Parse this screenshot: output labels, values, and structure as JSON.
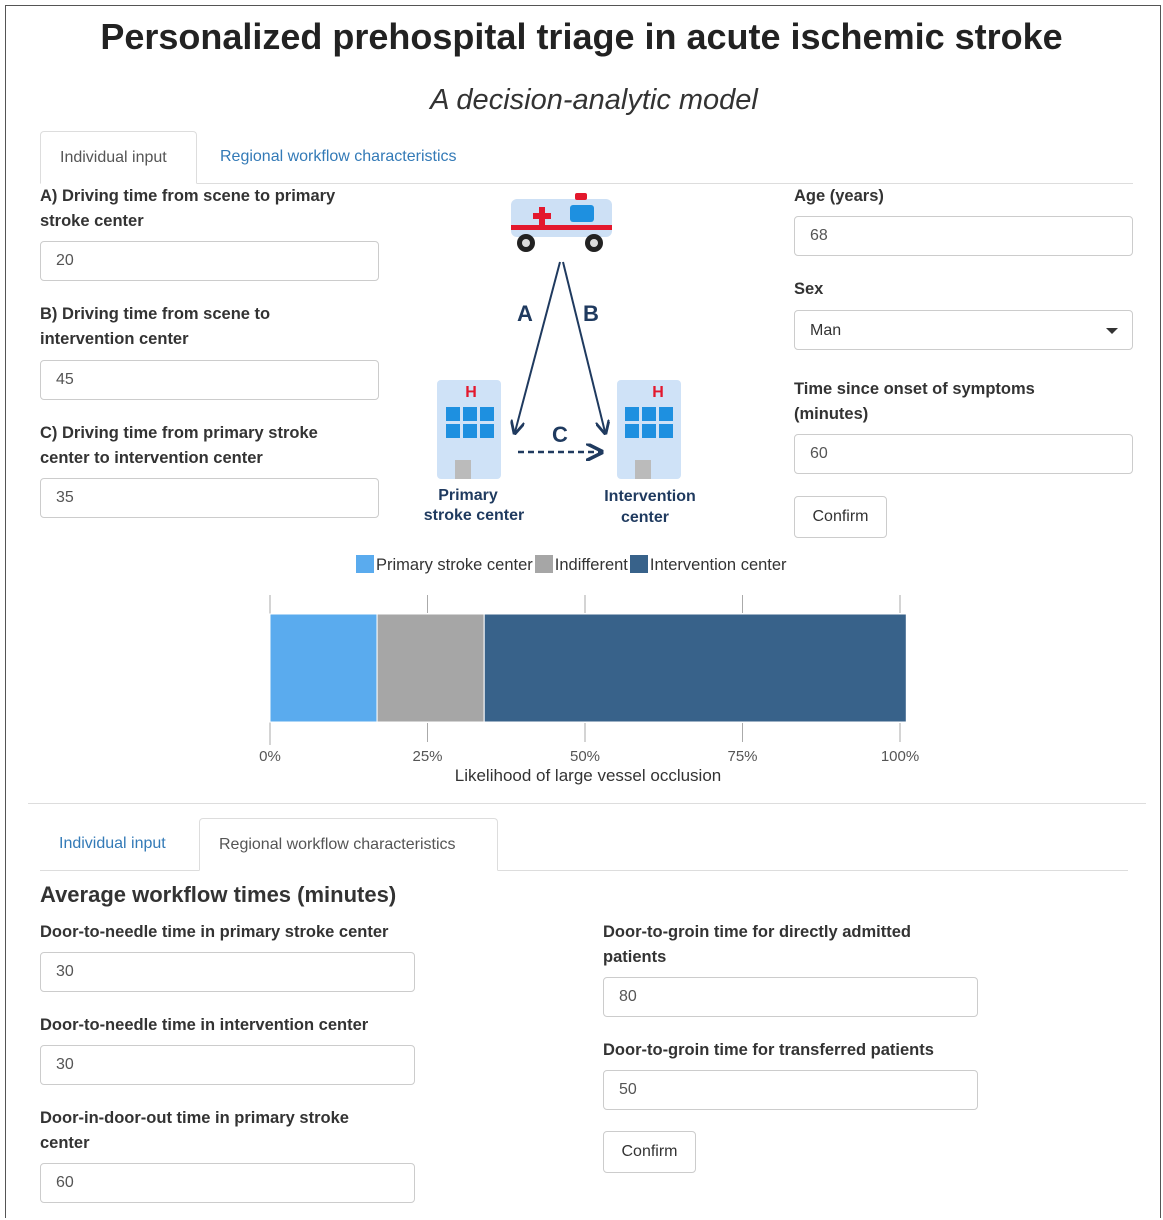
{
  "header": {
    "title": "Personalized prehospital triage in acute ischemic stroke",
    "subtitle": "A decision-analytic model"
  },
  "tabs_top": {
    "individual": "Individual input",
    "regional": "Regional workflow characteristics",
    "active": "individual"
  },
  "individual": {
    "a_label": "A) Driving time from scene to primary stroke center",
    "a_value": "20",
    "b_label": "B) Driving time from scene to intervention center",
    "b_value": "45",
    "c_label": "C) Driving time from primary stroke center to intervention center",
    "c_value": "35",
    "age_label": "Age (years)",
    "age_value": "68",
    "sex_label": "Sex",
    "sex_value": "Man",
    "onset_label": "Time since onset of symptoms (minutes)",
    "onset_value": "60",
    "confirm_label": "Confirm"
  },
  "diagram": {
    "route_a": "A",
    "route_b": "B",
    "route_c": "C",
    "hospital_mark": "H",
    "primary_label_1": "Primary",
    "primary_label_2": "stroke center",
    "intervention_label_1": "Intervention",
    "intervention_label_2": "center",
    "colors": {
      "ambulance": "#cde0f5",
      "cross": "#e3182d",
      "hospital": "#cfe2f7",
      "windows": "#1e90e0",
      "arrow": "#1f3a5f"
    }
  },
  "chart_data": {
    "type": "bar",
    "orientation": "horizontal-stacked",
    "series": [
      {
        "name": "Primary stroke center",
        "value": 17,
        "color": "#5aabee"
      },
      {
        "name": "Indifferent",
        "value": 17,
        "color": "#a6a6a6"
      },
      {
        "name": "Intervention center",
        "value": 67,
        "color": "#38628a"
      }
    ],
    "xlabel": "Likelihood of large vessel occlusion",
    "xlim": [
      0,
      100
    ],
    "ticks": [
      "0%",
      "25%",
      "50%",
      "75%",
      "100%"
    ],
    "legend_position": "top"
  },
  "tabs_bottom": {
    "individual": "Individual input",
    "regional": "Regional workflow characteristics",
    "active": "regional"
  },
  "regional": {
    "heading": "Average workflow times (minutes)",
    "dtn_primary_label": "Door-to-needle time in primary stroke center",
    "dtn_primary_value": "30",
    "dtn_intervention_label": "Door-to-needle time in intervention center",
    "dtn_intervention_value": "30",
    "dido_label": "Door-in-door-out time in primary stroke center",
    "dido_value": "60",
    "dtg_direct_label": "Door-to-groin time for directly admitted patients",
    "dtg_direct_value": "80",
    "dtg_transfer_label": "Door-to-groin time for transferred patients",
    "dtg_transfer_value": "50",
    "confirm_label": "Confirm"
  }
}
